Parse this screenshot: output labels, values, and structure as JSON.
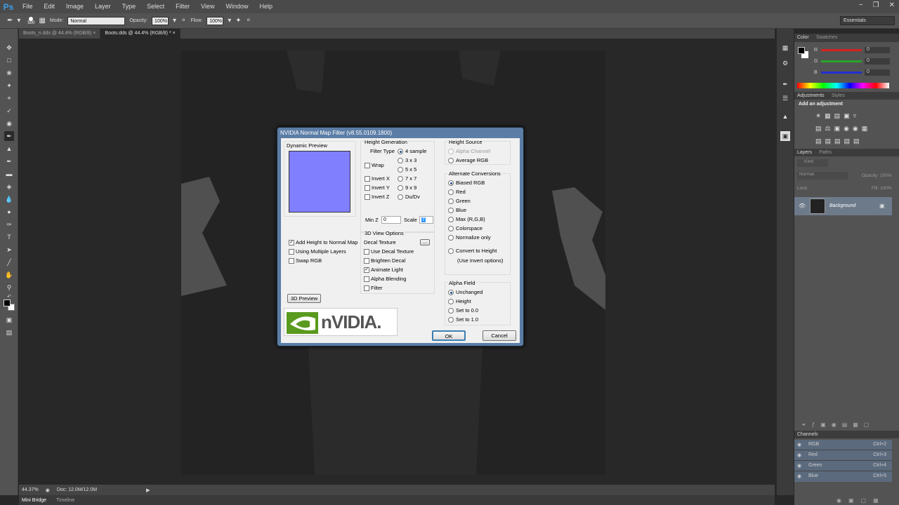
{
  "app": {
    "logo": "Ps"
  },
  "menu": [
    "File",
    "Edit",
    "Image",
    "Layer",
    "Type",
    "Select",
    "Filter",
    "View",
    "Window",
    "Help"
  ],
  "window_controls": [
    "−",
    "❐",
    "✕"
  ],
  "options": {
    "brush_size": "500",
    "mode_label": "Mode:",
    "mode_value": "Normal",
    "opacity_label": "Opacity:",
    "opacity_value": "100%",
    "flow_label": "Flow:",
    "flow_value": "100%"
  },
  "workspace": "Essentials",
  "tabs": [
    {
      "label": "Boots_n.dds @ 44.4% (RGB/8)",
      "close": "×"
    },
    {
      "label": "Boots.dds @ 44.4% (RGB/8) *",
      "close": "×"
    }
  ],
  "status": {
    "zoom": "44.37%",
    "doc": "Doc: 12.0M/12.0M"
  },
  "bottom_tabs": [
    "Mini Bridge",
    "Timeline"
  ],
  "color_panel": {
    "tabs": [
      "Color",
      "Swatches"
    ],
    "r_label": "R",
    "g_label": "G",
    "b_label": "B",
    "r": "0",
    "g": "0",
    "b": "0",
    "colors": {
      "r": "#d92020",
      "g": "#2aa52a",
      "b": "#2030d0"
    }
  },
  "adjustments": {
    "tabs": [
      "Adjustments",
      "Styles"
    ],
    "header": "Add an adjustment"
  },
  "layers": {
    "tabs": [
      "Layers",
      "Paths"
    ],
    "kind": "Kind",
    "blend": "Normal",
    "opacity_label": "Opacity:",
    "opacity": "100%",
    "lock_label": "Lock:",
    "fill_label": "Fill:",
    "fill": "100%",
    "layer_name": "Background"
  },
  "channels": {
    "tab": "Channels",
    "items": [
      {
        "name": "RGB",
        "shortcut": "Ctrl+2"
      },
      {
        "name": "Red",
        "shortcut": "Ctrl+3"
      },
      {
        "name": "Green",
        "shortcut": "Ctrl+4"
      },
      {
        "name": "Blue",
        "shortcut": "Ctrl+5"
      }
    ]
  },
  "dialog": {
    "title": "NVIDIA Normal Map Filter (v8.55.0109.1800)",
    "dynamic_preview": "Dynamic Preview",
    "preview_color": "#8080ff",
    "height_generation": "Height Generation",
    "filter_type": "Filter Type",
    "filters": [
      "4 sample",
      "3 x 3",
      "5 x 5",
      "7 x 7",
      "9 x 9",
      "Du/Dv"
    ],
    "wrap": "Wrap",
    "invert_x": "Invert X",
    "invert_y": "Invert Y",
    "invert_z": "Invert Z",
    "minz_label": "Min Z",
    "minz_value": "0",
    "scale_label": "Scale",
    "scale_value": "7",
    "add_height": "Add Height to Normal Map",
    "multiple_layers": "Using Multiple Layers",
    "swap_rgb": "Swap RGB",
    "view_options": "3D View Options",
    "decal_texture": "Decal Texture",
    "browse": "...",
    "use_decal": "Use Decal Texture",
    "brighten_decal": "Brighten Decal",
    "animate_light": "Animate Light",
    "alpha_blending": "Alpha Blending",
    "filter": "Filter",
    "preview3d": "3D Preview",
    "height_source": "Height Source",
    "alpha_channel": "Alpha Channel",
    "average_rgb": "Average RGB",
    "alt_conversions": "Alternate Conversions",
    "conversions": [
      "Biased RGB",
      "Red",
      "Green",
      "Blue",
      "Max (R,G,B)",
      "Colorspace",
      "Normalize only"
    ],
    "convert_height": "Convert to Height",
    "invert_options": "(Use Invert options)",
    "alpha_field": "Alpha Field",
    "alpha_opts": [
      "Unchanged",
      "Height",
      "Set to 0.0",
      "Set to 1.0"
    ],
    "ok": "OK",
    "cancel": "Cancel",
    "logo_text": "nVIDIA."
  }
}
